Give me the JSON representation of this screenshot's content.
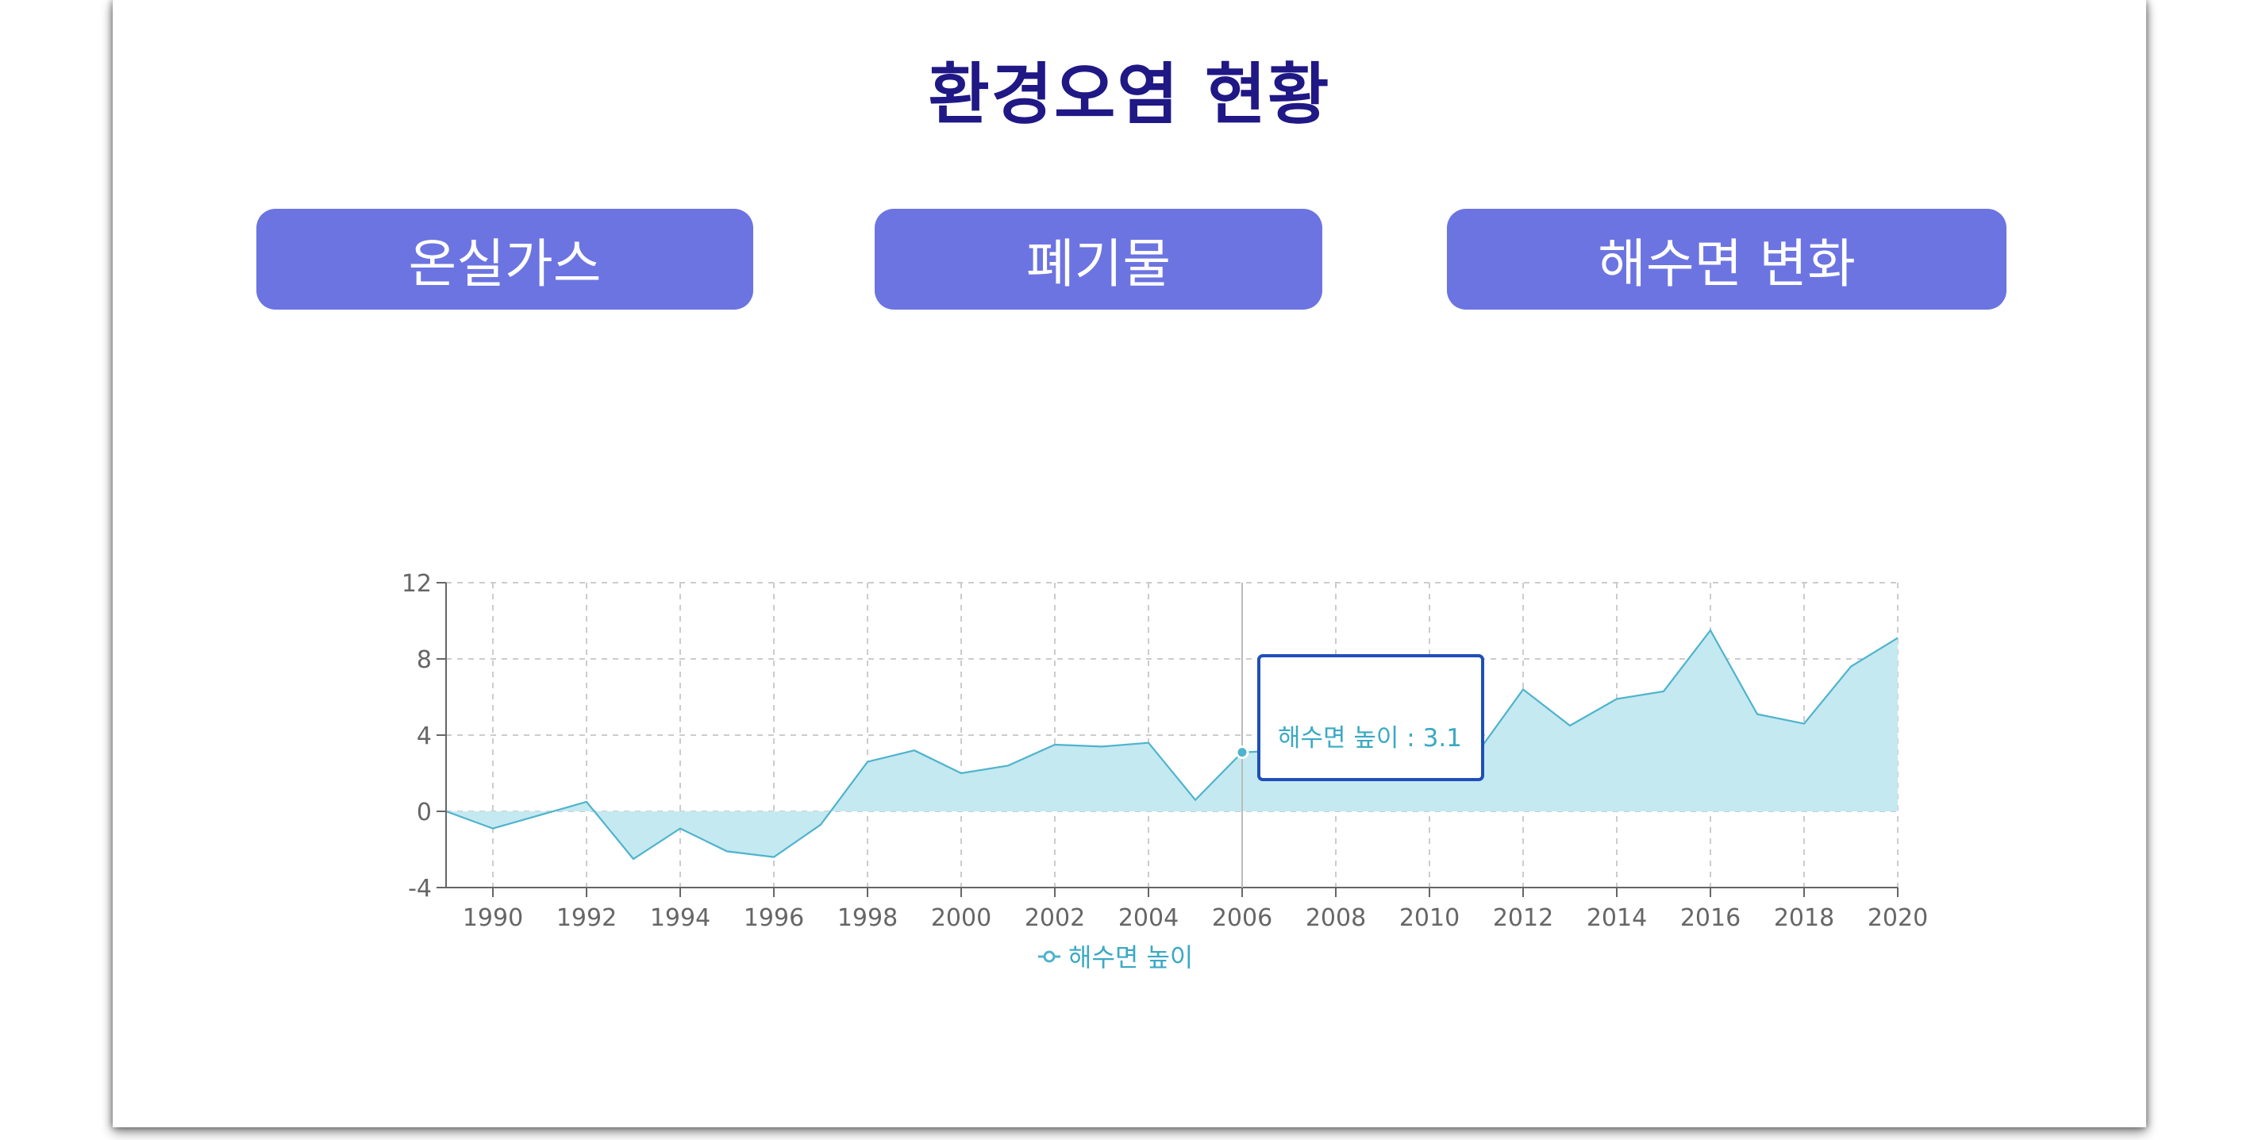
{
  "page": {
    "title": "환경오염 현황"
  },
  "tabs": [
    {
      "label": "온실가스"
    },
    {
      "label": "폐기물"
    },
    {
      "label": "해수면 변화"
    }
  ],
  "colors": {
    "title": "#1f1885",
    "tab_bg": "#6c74e1",
    "series_line": "#4fb3cc",
    "series_fill": "#c4e9f1",
    "tooltip_border": "#1f4fb8"
  },
  "tooltip": {
    "text": "해수면 높이 : 3.1",
    "year": 2006,
    "value": 3.1
  },
  "legend": {
    "icon": "line-dot-icon",
    "label": "해수면 높이"
  },
  "chart_data": {
    "type": "area",
    "xlabel": "",
    "ylabel": "",
    "x": [
      1989,
      1990,
      1991,
      1992,
      1993,
      1994,
      1995,
      1996,
      1997,
      1998,
      1999,
      2000,
      2001,
      2002,
      2003,
      2004,
      2005,
      2006,
      2007,
      2008,
      2009,
      2010,
      2011,
      2012,
      2013,
      2014,
      2015,
      2016,
      2017,
      2018,
      2019,
      2020
    ],
    "series": [
      {
        "name": "해수면 높이",
        "values": [
          0.0,
          -0.9,
          -0.2,
          0.5,
          -2.5,
          -0.9,
          -2.1,
          -2.4,
          -0.7,
          2.6,
          3.2,
          2.0,
          2.4,
          3.5,
          3.4,
          3.6,
          0.6,
          3.1,
          3.2,
          3.3,
          3.2,
          2.4,
          3.0,
          6.4,
          4.5,
          5.9,
          6.3,
          9.5,
          5.1,
          4.6,
          7.6,
          9.1
        ]
      }
    ],
    "xticks": [
      "1990",
      "1992",
      "1994",
      "1996",
      "1998",
      "2000",
      "2002",
      "2004",
      "2006",
      "2008",
      "2010",
      "2012",
      "2014",
      "2016",
      "2018",
      "2020"
    ],
    "yticks": [
      "-4",
      "0",
      "4",
      "8",
      "12"
    ],
    "xlim": [
      1989,
      2020
    ],
    "ylim": [
      -4,
      12
    ],
    "grid": true,
    "legend_position": "bottom-center"
  }
}
